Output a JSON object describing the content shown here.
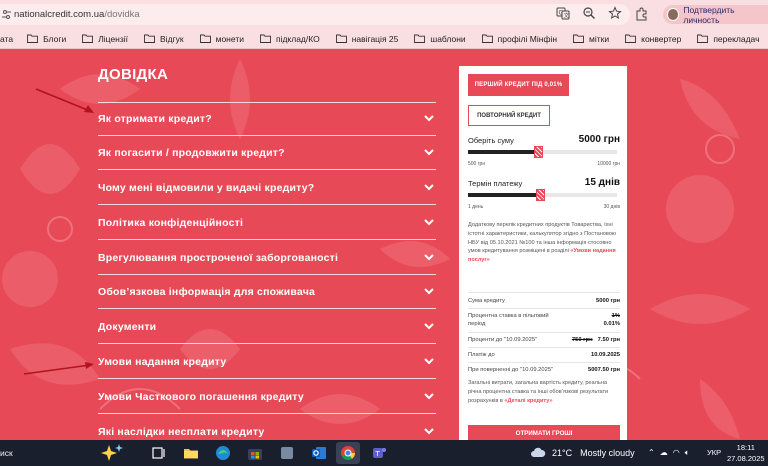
{
  "browser": {
    "url_domain": "nationalcredit.com.ua",
    "url_path": "/dovidka",
    "profile_label": "Подтвердить личность"
  },
  "bookmarks": [
    {
      "label": "ата"
    },
    {
      "label": "Блоги"
    },
    {
      "label": "Ліцензії"
    },
    {
      "label": "Відгук"
    },
    {
      "label": "монети"
    },
    {
      "label": "підклад/КО"
    },
    {
      "label": "навігація 25"
    },
    {
      "label": "шаблони"
    },
    {
      "label": "профілі Мінфін"
    },
    {
      "label": "мітки"
    },
    {
      "label": "конвертер"
    },
    {
      "label": "перекладач"
    }
  ],
  "faq": {
    "title": "ДОВІДКА",
    "items": [
      "Як отримати кредит?",
      "Як погасити / продовжити кредит?",
      "Чому мені відмовили у видачі кредиту?",
      "Політика конфіденційності",
      "Врегулювання простроченої заборгованості",
      "Обов’язкова інформація для споживача",
      "Документи",
      "Умови надання кредиту",
      "Умови Часткового погашення кредиту",
      "Які наслідки несплати кредиту"
    ]
  },
  "calculator": {
    "first_credit_btn": "ПЕРШИЙ КРЕДИТ ПІД 0,01%",
    "repeat_credit_btn": "ПОВТОРНИЙ КРЕДИТ",
    "amount_label": "Оберіть суму",
    "amount_value": "5000 грн",
    "amount_min": "500 грн",
    "amount_max": "10000 грн",
    "amount_fraction": 0.47,
    "term_label": "Термін платежу",
    "term_value": "15 днів",
    "term_min": "1 день",
    "term_max": "30 днів",
    "term_fraction": 0.48,
    "note_text": "Додаткову перелік кредитних продуктів Товариства, їхні істотні характеристики, калькулятор згідно з Постановою НБУ від 05.10.2021 №100 та інша інформація стосовно умов кредитування розміщені в розділі",
    "note_link": "«Умови надання послуг»",
    "rows": {
      "sum_label": "Сума кредиту",
      "sum_value": "5000 грн",
      "rate_label": "Процентна ставка в пільговий період",
      "rate_old": "1%",
      "rate_value": "0.01%",
      "interest_label": "Проценти до \"10.09.2025\"",
      "interest_old": "750 грн",
      "interest_value": "7.50 грн",
      "payment_label": "Платіж до",
      "payment_value": "10.09.2025",
      "total_label": "При поверненні до \"10.09.2025\"",
      "total_value": "5007.50 грн"
    },
    "bottom_note": "Загальні витрати, загальна вартість кредиту, реальна річна процентна ставка та інші обов’язкові результати розрахунків в",
    "bottom_link": "«Деталі кредиту»",
    "get_money_btn": "ОТРИМАТИ ГРОШІ"
  },
  "taskbar": {
    "search_text": "иск",
    "temperature": "21°C",
    "weather": "Mostly cloudy",
    "language": "УКР",
    "time": "18:11",
    "date": "27.08.2025"
  },
  "colors": {
    "brand_red": "#e84957",
    "chrome_pink": "#f9dfe2",
    "taskbar": "#1a1f2e"
  }
}
